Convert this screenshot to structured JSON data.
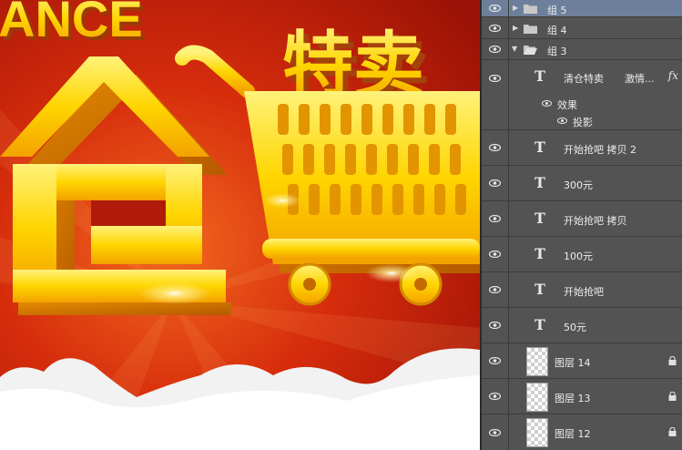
{
  "canvas": {
    "top_text": "ANCE",
    "title_text": "特卖"
  },
  "colors": {
    "panel_bg": "#535353",
    "selected_row": "#6d7f9b",
    "poster_red": "#c8200a",
    "gold": "#ffd200"
  },
  "layers": [
    {
      "label": "组 5",
      "kind": "group",
      "expanded": false
    },
    {
      "label": "组 4",
      "kind": "group",
      "expanded": false
    },
    {
      "label": "组 3",
      "kind": "group",
      "expanded": true
    },
    {
      "label": "清仓特卖",
      "extra": "激情...",
      "fx": "fx",
      "kind": "text"
    },
    {
      "label": "效果",
      "kind": "effect"
    },
    {
      "label": "投影",
      "kind": "effect"
    },
    {
      "label": "开始抢吧 拷贝 2",
      "kind": "text"
    },
    {
      "label": "300元",
      "kind": "text"
    },
    {
      "label": "开始抢吧 拷贝",
      "kind": "text"
    },
    {
      "label": "100元",
      "kind": "text"
    },
    {
      "label": "开始抢吧",
      "kind": "text"
    },
    {
      "label": "50元",
      "kind": "text"
    },
    {
      "label": "图层 14",
      "kind": "pixel",
      "locked": true
    },
    {
      "label": "图层 13",
      "kind": "pixel",
      "locked": true
    },
    {
      "label": "图层 12",
      "kind": "pixel",
      "locked": true
    }
  ]
}
